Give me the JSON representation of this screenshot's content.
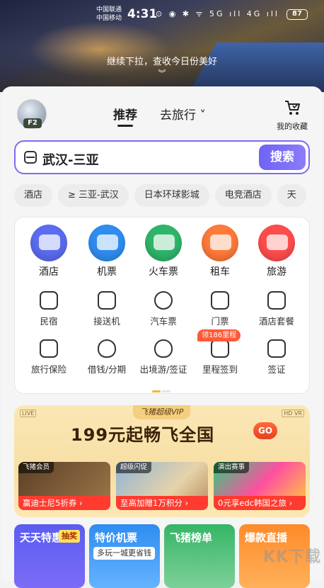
{
  "status_bar": {
    "carrier_1": "中国联通",
    "carrier_2": "中国移动",
    "time": "4:31",
    "icons": "⊙ ◉ ✱ ᯤ 5G ıll 4G ıll",
    "battery": "87"
  },
  "hero": {
    "pull_hint": "继续下拉，查收今日份美好",
    "pull_arrow": "︾"
  },
  "header": {
    "avatar_badge": "F2",
    "tabs": [
      {
        "label": "推荐",
        "active": true
      },
      {
        "label": "去旅行 ˅",
        "active": false
      }
    ],
    "favorites_label": "我的收藏",
    "favorites_icon": "cart-icon"
  },
  "search": {
    "value": "武汉-三亚",
    "button": "搜索"
  },
  "chips": [
    "酒店",
    "≥ 三亚-武汉",
    "日本环球影城",
    "电竞酒店",
    "天"
  ],
  "services": {
    "main": [
      {
        "label": "酒店",
        "color": "#5b6cf0"
      },
      {
        "label": "机票",
        "color": "#2f8df0"
      },
      {
        "label": "火车票",
        "color": "#2fb56a"
      },
      {
        "label": "租车",
        "color": "#ff7a3a"
      },
      {
        "label": "旅游",
        "color": "#ff4d4d"
      }
    ],
    "row2": [
      "民宿",
      "接送机",
      "汽车票",
      "门票",
      "酒店套餐"
    ],
    "row3": [
      "旅行保险",
      "借钱/分期",
      "出境游/签证",
      "里程签到",
      "签证"
    ],
    "miles_tag": "领186里程"
  },
  "vip": {
    "badge": "飞猪超级VIP",
    "corner_left": "LIVE",
    "corner_right": "HD VR",
    "headline": "199元起畅飞全国",
    "go": "GO",
    "cards": [
      {
        "tag": "飞猪会员",
        "foot": "赢迪士尼5折券 ›",
        "color": "#7a5a3a"
      },
      {
        "tag": "超级闪促",
        "foot": "至高加赠1万积分 ›",
        "color": "#c7a877"
      },
      {
        "tag": "演出赛事",
        "foot": "0元享edc韩国之旅 ›",
        "color": "#3ab56a"
      }
    ]
  },
  "promos": [
    {
      "title": "天天特惠",
      "badge": "抽奖",
      "sub": "",
      "color": "#5b5cf2"
    },
    {
      "title": "特价机票",
      "badge": "",
      "sub": "多玩一城更省钱",
      "color": "#2f8df0"
    },
    {
      "title": "飞猪榜单",
      "badge": "",
      "sub": "",
      "color": "#35b565"
    },
    {
      "title": "爆款直播",
      "badge": "",
      "sub": "",
      "color": "#ff8a2a"
    }
  ],
  "watermark": "KK下载"
}
